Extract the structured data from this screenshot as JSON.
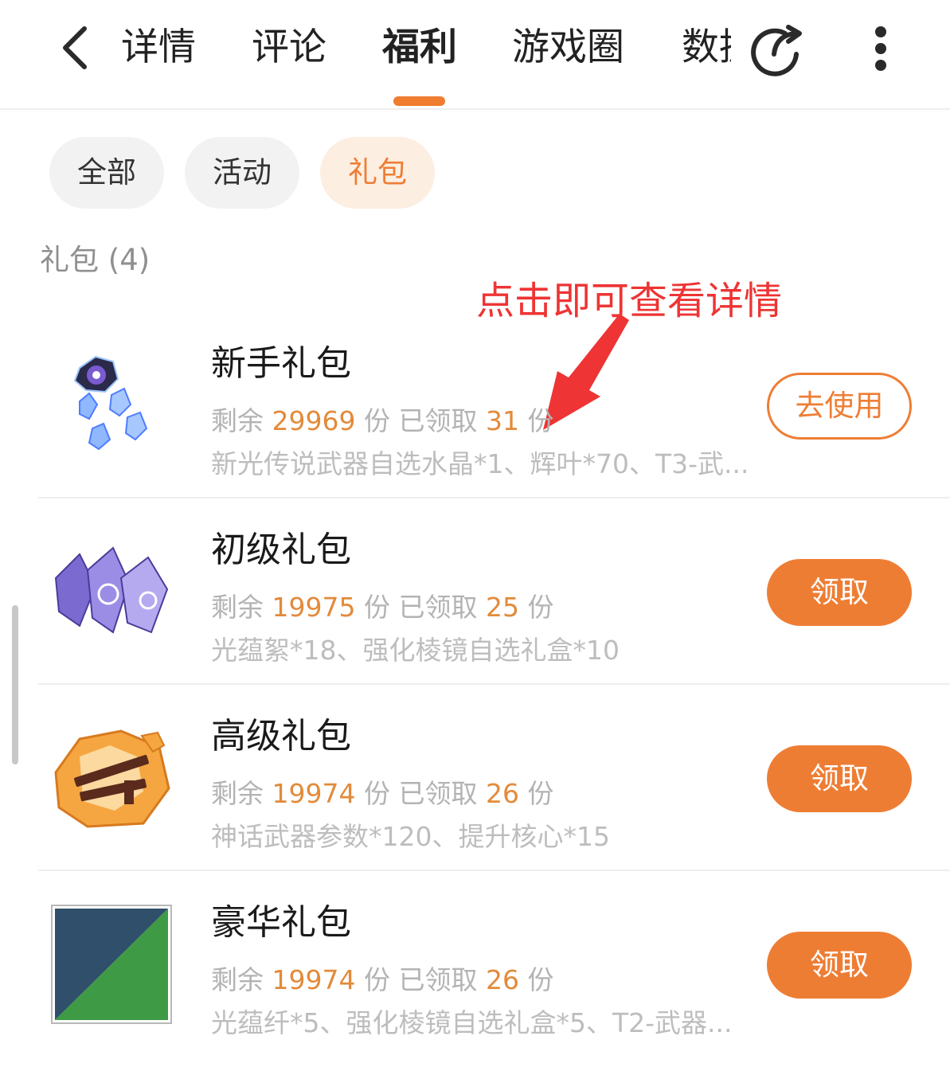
{
  "header": {
    "tabs": [
      {
        "label": "详情"
      },
      {
        "label": "评论"
      },
      {
        "label": "福利"
      },
      {
        "label": "游戏圈"
      },
      {
        "label": "数据"
      }
    ],
    "active_tab": "福利",
    "accent_color": "#f07c2f",
    "icons": [
      "chevron-left-icon",
      "share-icon",
      "more-vertical-icon"
    ]
  },
  "filters": {
    "chips": [
      {
        "label": "全部"
      },
      {
        "label": "活动"
      },
      {
        "label": "礼包"
      }
    ],
    "active": "礼包"
  },
  "section": {
    "title": "礼包 (4)"
  },
  "annotation": {
    "text": "点击即可查看详情",
    "color": "#ee3434"
  },
  "gifts": [
    {
      "name": "新手礼包",
      "remaining_prefix": "剩余",
      "remaining": "29969",
      "unit1": "份",
      "claimed_prefix": "已领取",
      "claimed": "31",
      "unit2": "份",
      "contents": "新光传说武器自选水晶*1、辉叶*70、T3-武...",
      "button": "去使用"
    },
    {
      "name": "初级礼包",
      "remaining_prefix": "剩余",
      "remaining": "19975",
      "unit1": "份",
      "claimed_prefix": "已领取",
      "claimed": "25",
      "unit2": "份",
      "contents": "光蕴絮*18、强化棱镜自选礼盒*10",
      "button": "领取"
    },
    {
      "name": "高级礼包",
      "remaining_prefix": "剩余",
      "remaining": "19974",
      "unit1": "份",
      "claimed_prefix": "已领取",
      "claimed": "26",
      "unit2": "份",
      "contents": "神话武器参数*120、提升核心*15",
      "button": "领取"
    },
    {
      "name": "豪华礼包",
      "remaining_prefix": "剩余",
      "remaining": "19974",
      "unit1": "份",
      "claimed_prefix": "已领取",
      "claimed": "26",
      "unit2": "份",
      "contents": "光蕴纤*5、强化棱镜自选礼盒*5、T2-武器...",
      "button": "领取"
    }
  ]
}
